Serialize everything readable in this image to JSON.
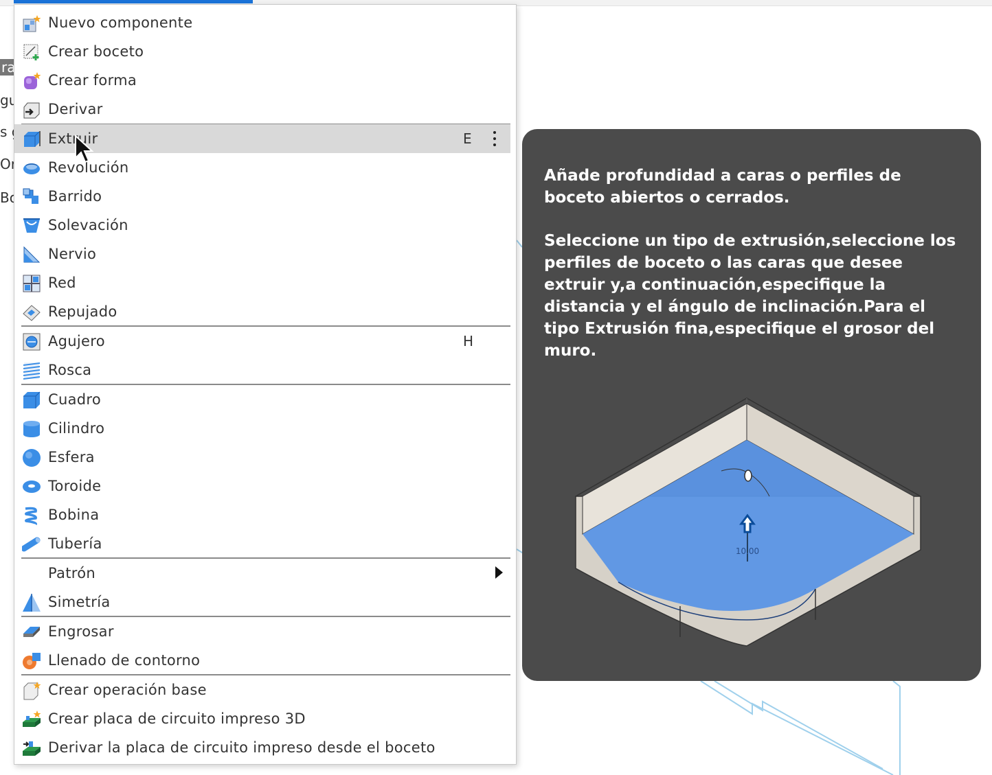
{
  "menu": {
    "items": [
      {
        "label": "Nuevo componente",
        "icon": "new-component-icon"
      },
      {
        "label": "Crear boceto",
        "icon": "create-sketch-icon"
      },
      {
        "label": "Crear forma",
        "icon": "create-form-icon"
      },
      {
        "label": "Derivar",
        "icon": "derive-icon"
      },
      {
        "label": "Extruir",
        "icon": "extrude-icon",
        "shortcut": "E",
        "hovered": true
      },
      {
        "label": "Revolución",
        "icon": "revolve-icon"
      },
      {
        "label": "Barrido",
        "icon": "sweep-icon"
      },
      {
        "label": "Solevación",
        "icon": "loft-icon"
      },
      {
        "label": "Nervio",
        "icon": "rib-icon"
      },
      {
        "label": "Red",
        "icon": "web-icon"
      },
      {
        "label": "Repujado",
        "icon": "emboss-icon"
      },
      {
        "label": "Agujero",
        "icon": "hole-icon",
        "shortcut": "H"
      },
      {
        "label": "Rosca",
        "icon": "thread-icon"
      },
      {
        "label": "Cuadro",
        "icon": "box-icon"
      },
      {
        "label": "Cilindro",
        "icon": "cylinder-icon"
      },
      {
        "label": "Esfera",
        "icon": "sphere-icon"
      },
      {
        "label": "Toroide",
        "icon": "torus-icon"
      },
      {
        "label": "Bobina",
        "icon": "coil-icon"
      },
      {
        "label": "Tubería",
        "icon": "pipe-icon"
      },
      {
        "label": "Patrón",
        "icon": "",
        "submenu": true
      },
      {
        "label": "Simetría",
        "icon": "mirror-icon"
      },
      {
        "label": "Engrosar",
        "icon": "thicken-icon"
      },
      {
        "label": "Llenado de contorno",
        "icon": "boundary-fill-icon"
      },
      {
        "label": "Crear operación base",
        "icon": "base-feature-icon"
      },
      {
        "label": "Crear placa de circuito impreso 3D",
        "icon": "pcb-3d-icon"
      },
      {
        "label": "Derivar la placa de circuito impreso desde el boceto",
        "icon": "derive-pcb-icon"
      }
    ]
  },
  "tooltip": {
    "paragraph1": "Añade profundidad a caras o perfiles de boceto abiertos o cerrados.",
    "paragraph2": "Seleccione un tipo de extrusión,seleccione los perfiles de boceto o las caras que desee extruir y,a continuación,especifique la distancia y el ángulo de inclinación.Para el tipo Extrusión fina,especifique el grosor del muro.",
    "illustration_dimension": "10.00"
  },
  "background": {
    "left_fragments": [
      "ra",
      "gu",
      "s g",
      "Or",
      "Bo"
    ]
  },
  "colors": {
    "accent": "#1a73d9",
    "tooltip_bg": "#4b4b4b",
    "hover_bg": "#d9d9d9",
    "icon_blue": "#3b8ee6",
    "face_blue": "#5b95e6"
  }
}
